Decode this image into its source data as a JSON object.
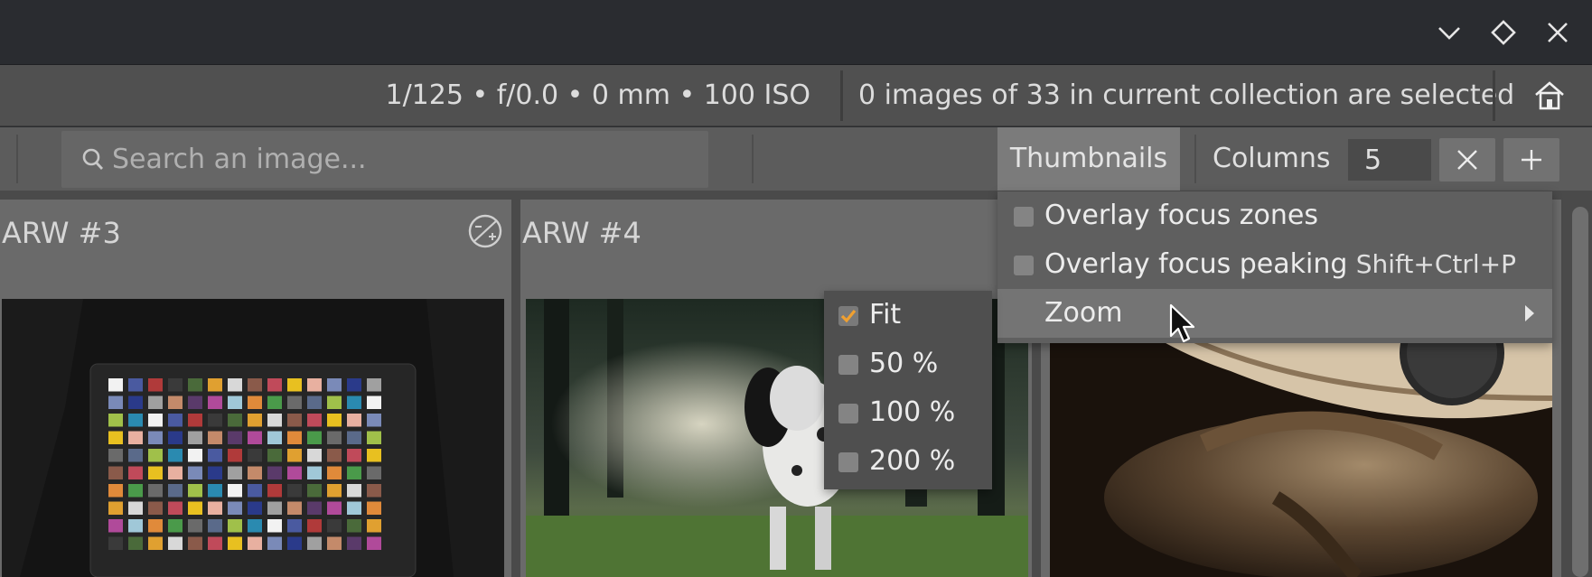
{
  "window": {
    "controls": [
      {
        "name": "minimize-button",
        "icon": "chevron-down-icon"
      },
      {
        "name": "maximize-button",
        "icon": "diamond-icon"
      },
      {
        "name": "close-button",
        "icon": "close-icon"
      }
    ]
  },
  "infobar": {
    "exif": "1/125 • f/0.0 • 0 mm • 100 ISO",
    "selection": "0 images of 33 in current collection are selected",
    "home_icon": "home-icon"
  },
  "toolbar": {
    "search_placeholder": "Search an image...",
    "thumbnails_label": "Thumbnails",
    "columns_label": "Columns",
    "columns_value": "5",
    "remove_icon": "close-icon",
    "add_icon": "plus-icon"
  },
  "gallery": {
    "cards": [
      {
        "title": "ARW #3"
      },
      {
        "title": "ARW #4"
      }
    ]
  },
  "menu": {
    "items": [
      {
        "label": "Overlay focus zones",
        "checked": false
      },
      {
        "label": "Overlay focus peaking",
        "shortcut": "Shift+Ctrl+P",
        "checked": false
      },
      {
        "label": "Zoom",
        "submenu": true
      }
    ]
  },
  "zoom_submenu": {
    "items": [
      {
        "label": "Fit",
        "checked": true
      },
      {
        "label": "50 %",
        "checked": false
      },
      {
        "label": "100 %",
        "checked": false
      },
      {
        "label": "200 %",
        "checked": false
      }
    ]
  },
  "colors": {
    "accent_check": "#f0a030",
    "menu_bg": "#5f5f5f",
    "menu_highlight": "#747474"
  }
}
